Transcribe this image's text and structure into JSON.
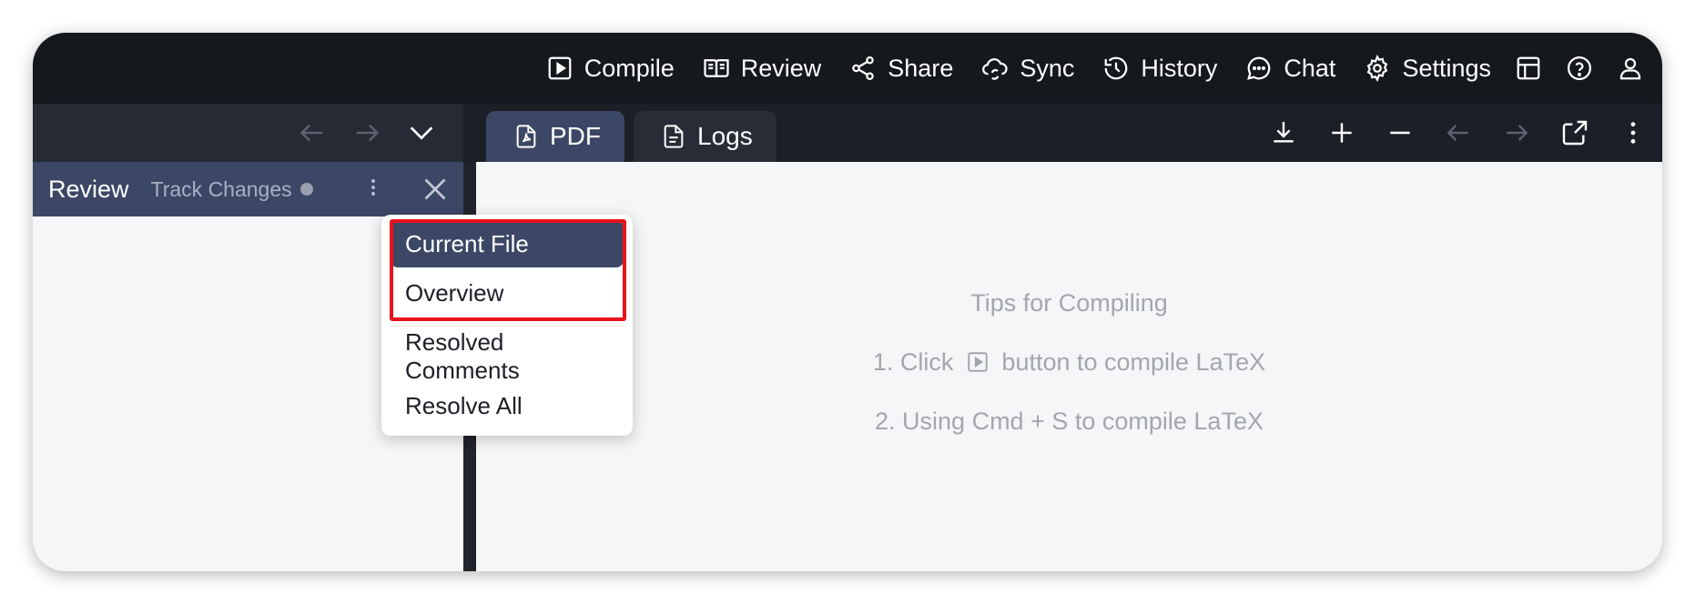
{
  "toolbar": {
    "compile": "Compile",
    "review": "Review",
    "share": "Share",
    "sync": "Sync",
    "history": "History",
    "chat": "Chat",
    "settings": "Settings"
  },
  "tabs": [
    {
      "label": "PDF",
      "active": true
    },
    {
      "label": "Logs",
      "active": false
    }
  ],
  "review_panel": {
    "title": "Review",
    "track_changes": "Track Changes"
  },
  "dropdown": {
    "items": [
      "Current File",
      "Overview",
      "Resolved Comments",
      "Resolve All"
    ],
    "selected": "Current File"
  },
  "tips": {
    "title": "Tips for Compiling",
    "line1_prefix": "1. Click",
    "line1_suffix": "button to compile LaTeX",
    "line2": "2. Using Cmd + S to compile LaTeX"
  },
  "colors": {
    "topbar": "#15181d",
    "accent": "#3c4766",
    "highlight": "#e8131c"
  }
}
